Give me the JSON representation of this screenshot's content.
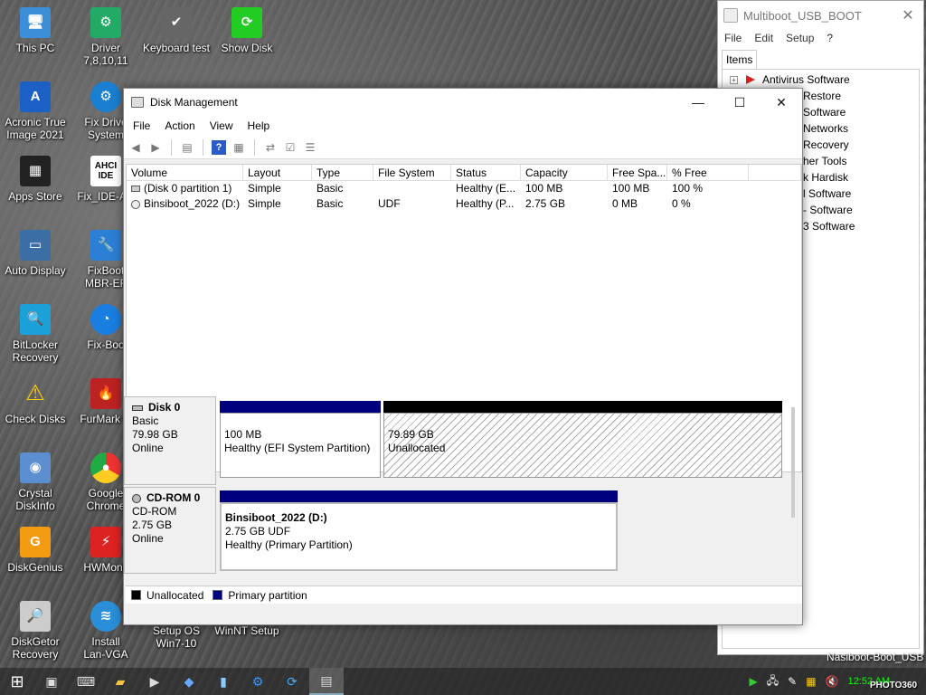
{
  "desktop": {
    "icons": [
      {
        "label": "This PC"
      },
      {
        "label": "Driver\n7,8,10,11"
      },
      {
        "label": "Keyboard test"
      },
      {
        "label": "Show Disk"
      },
      {
        "label": "Acronic True\nImage 2021"
      },
      {
        "label": "Fix Drive\nSystem"
      },
      {
        "label": "Apps Store"
      },
      {
        "label": "Fix_IDE-AH"
      },
      {
        "label": "Auto Display"
      },
      {
        "label": "FixBoot\nMBR-EF"
      },
      {
        "label": "BitLocker\nRecovery"
      },
      {
        "label": "Fix-Boo"
      },
      {
        "label": "Check Disks"
      },
      {
        "label": "FurMark G"
      },
      {
        "label": "Crystal\nDiskInfo"
      },
      {
        "label": "Google\nChrome"
      },
      {
        "label": "DiskGenius"
      },
      {
        "label": "HWMonit"
      },
      {
        "label": "DiskGetor\nRecovery"
      },
      {
        "label": "Install\nLan-VGA"
      },
      {
        "label": "Setup OS\nWin7-10"
      },
      {
        "label": "WinNT Setup"
      }
    ],
    "ahci_badge": "AHCI\nIDE",
    "bottom_right_label": "Nasiboot-Boot_USB",
    "watermark": "PHOTO360"
  },
  "multiboot": {
    "title": "Multiboot_USB_BOOT",
    "menu": [
      "File",
      "Edit",
      "Setup",
      "?"
    ],
    "tab": "Items",
    "tree": [
      "Antivirus Software",
      "Restore",
      "Software",
      "Networks",
      "Recovery",
      "her Tools",
      "k Hardisk",
      "l Software",
      "- Software",
      "3 Software"
    ]
  },
  "diskmgmt": {
    "title": "Disk Management",
    "menu": [
      "File",
      "Action",
      "View",
      "Help"
    ],
    "columns": [
      "Volume",
      "Layout",
      "Type",
      "File System",
      "Status",
      "Capacity",
      "Free Spa...",
      "% Free"
    ],
    "rows": [
      [
        "(Disk 0 partition 1)",
        "Simple",
        "Basic",
        "",
        "Healthy (E...",
        "100 MB",
        "100 MB",
        "100 %"
      ],
      [
        "Binsiboot_2022 (D:)",
        "Simple",
        "Basic",
        "UDF",
        "Healthy (P...",
        "2.75 GB",
        "0 MB",
        "0 %"
      ]
    ],
    "disk0": {
      "name": "Disk 0",
      "type": "Basic",
      "size": "79.98 GB",
      "status": "Online",
      "part1": {
        "size": "100 MB",
        "status": "Healthy (EFI System Partition)"
      },
      "part2": {
        "size": "79.89 GB",
        "status": "Unallocated"
      }
    },
    "cdrom0": {
      "name": "CD-ROM 0",
      "type": "CD-ROM",
      "size": "2.75 GB",
      "status": "Online",
      "part": {
        "name": "Binsiboot_2022  (D:)",
        "size": "2.75 GB UDF",
        "status": "Healthy (Primary Partition)"
      }
    },
    "legend": {
      "unallocated": "Unallocated",
      "primary": "Primary partition"
    },
    "colors": {
      "primary": "#00007f",
      "unallocated": "#000000"
    }
  },
  "taskbar": {
    "clock": "12:52 AM"
  }
}
